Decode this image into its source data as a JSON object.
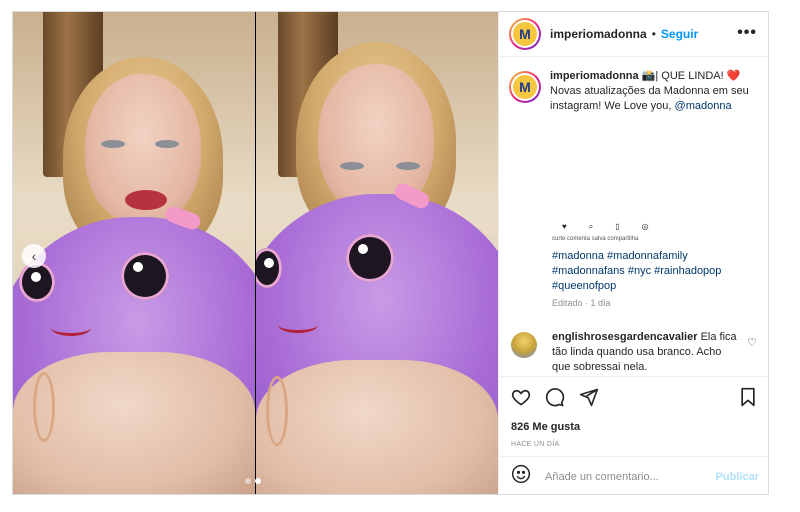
{
  "post": {
    "username": "imperiomadonna",
    "separator": "•",
    "follow_label": "Seguir",
    "more_icon": "more-horizontal-icon",
    "avatar_letter": "M",
    "caption": {
      "username": "imperiomadonna",
      "emoji": "📸",
      "text": "| QUE LINDA! ❤️ Novas atualizações da Madonna em seu instagram! We Love you,",
      "mention": "@madonna"
    },
    "mini_icons": [
      "♥",
      "⌕",
      "▯",
      "◎"
    ],
    "mini_labels": "curte comenta salva compartilha",
    "hashtags": "#madonna #madonnafamily #madonnafans #nyc #rainhadopop #queenofpop",
    "edited": "Editado · 1 día",
    "comment": {
      "username": "englishrosesgardencavalier",
      "text": "Ela fica tão linda quando usa branco. Acho que sobressai nela."
    },
    "likes": "826 Me gusta",
    "time_ago": "HACE UN DÍA",
    "comment_placeholder": "Añade un comentario...",
    "publish_label": "Publicar"
  },
  "media": {
    "slides": 2,
    "active_slide": 2
  },
  "colors": {
    "link_blue": "#0095f6",
    "mention_blue": "#00376b",
    "publish_disabled": "#b2dffc",
    "plush_purple": "#a86bd6"
  }
}
